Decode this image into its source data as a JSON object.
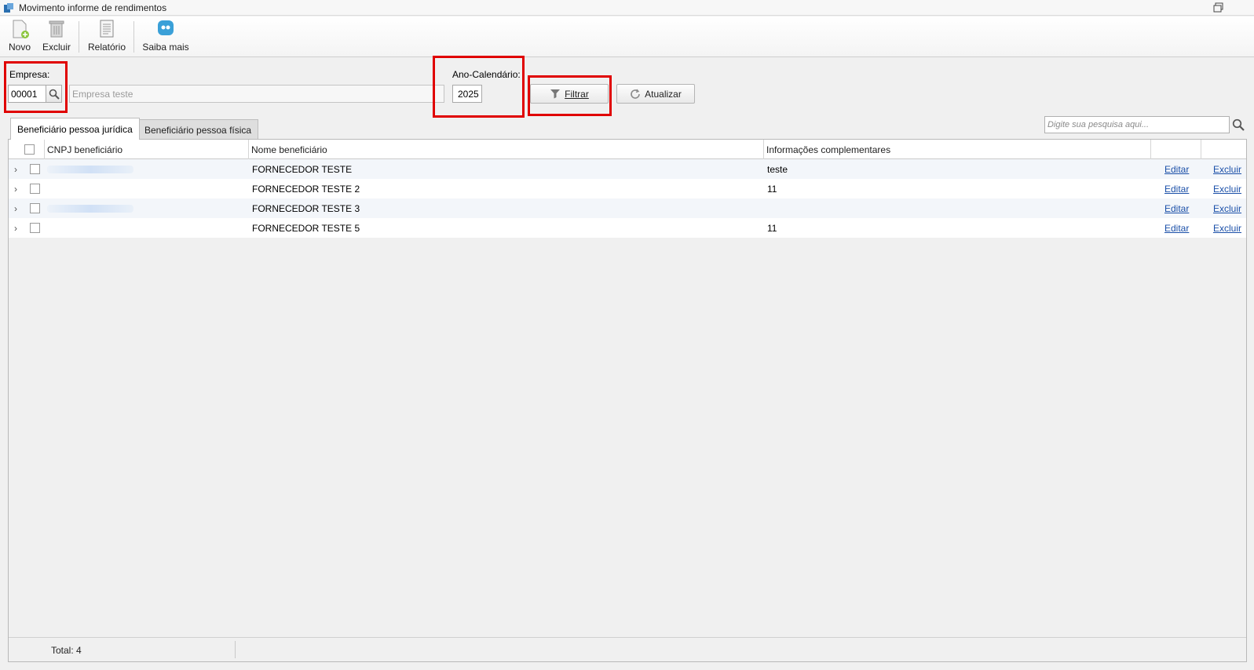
{
  "window": {
    "title": "Movimento informe de rendimentos"
  },
  "toolbar": {
    "novo_label": "Novo",
    "excluir_label": "Excluir",
    "relatorio_label": "Relatório",
    "saiba_mais_label": "Saiba mais"
  },
  "filters": {
    "empresa_label": "Empresa:",
    "empresa_code": "00001",
    "empresa_name": "Empresa teste",
    "ano_label": "Ano-Calendário:",
    "ano_value": "2025",
    "filtrar_label": "Filtrar",
    "atualizar_label": "Atualizar"
  },
  "tabs": [
    {
      "label": "Beneficiário pessoa jurídica",
      "active": true
    },
    {
      "label": "Beneficiário pessoa física",
      "active": false
    }
  ],
  "search": {
    "placeholder": "Digite sua pesquisa aqui..."
  },
  "grid": {
    "columns": [
      "CNPJ beneficiário",
      "Nome beneficiário",
      "Informações complementares"
    ],
    "rows": [
      {
        "cnpj": "",
        "nome": "FORNECEDOR TESTE",
        "info": "teste",
        "edit": "Editar",
        "delete": "Excluir"
      },
      {
        "cnpj": "",
        "nome": "FORNECEDOR TESTE 2",
        "info": "11",
        "edit": "Editar",
        "delete": "Excluir"
      },
      {
        "cnpj": "",
        "nome": "FORNECEDOR TESTE 3",
        "info": "",
        "edit": "Editar",
        "delete": "Excluir"
      },
      {
        "cnpj": "",
        "nome": "FORNECEDOR TESTE 5",
        "info": "11",
        "edit": "Editar",
        "delete": "Excluir"
      }
    ],
    "footer_total": "Total: 4"
  },
  "colors": {
    "highlight": "#e00000",
    "link": "#1a4fa8"
  }
}
